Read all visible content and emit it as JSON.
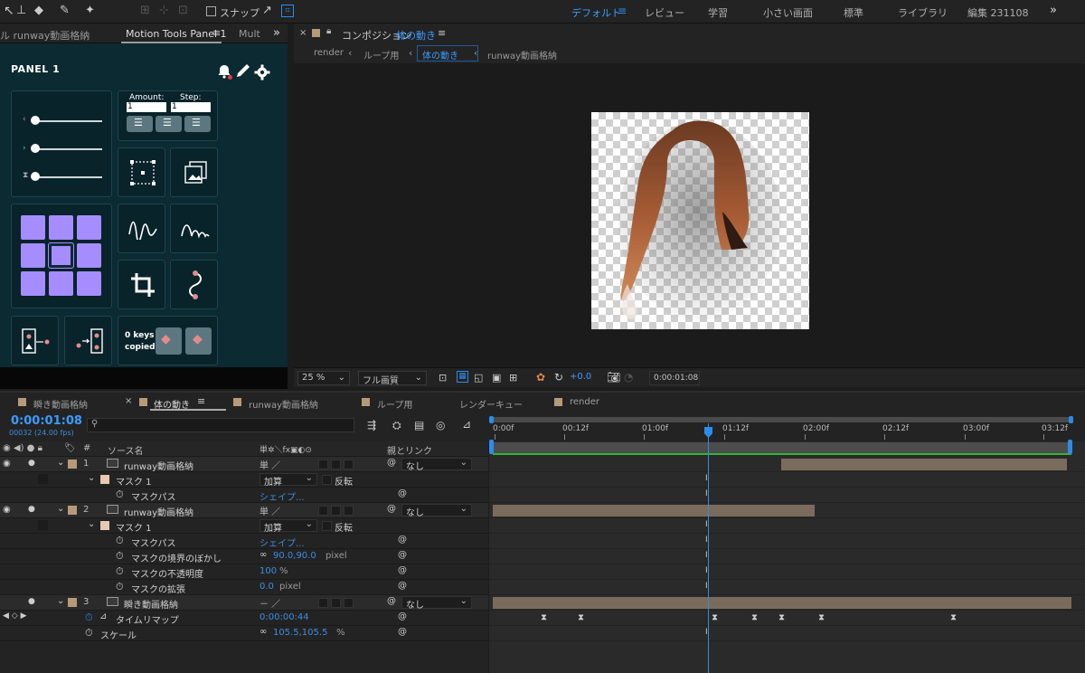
{
  "topbar": {
    "snap_label": "スナップ",
    "workspaces": [
      "デフォルト",
      "レビュー",
      "学習",
      "小さい画面",
      "標準",
      "ライブラリ",
      "編集 231108"
    ],
    "active_workspace": "デフォルト"
  },
  "left_tabs": {
    "project_tab": "ル runway動画格納",
    "panel_tab": "Motion Tools Panel 1",
    "multi_tab": "Mult"
  },
  "motion_tools": {
    "panel_title": "PANEL 1",
    "amount_label": "Amount:",
    "step_label": "Step:",
    "amount_value": "1",
    "step_value": "1",
    "keys_copied": "0 keys copied"
  },
  "comp": {
    "tab_label": "コンポジション",
    "comp_name": "体の動き",
    "breadcrumbs": [
      "render",
      "ループ用",
      "体の動き",
      "runway動画格納"
    ],
    "zoom": "25 %",
    "quality": "フル画質",
    "exposure": "+0.0",
    "timecode": "0:00:01:08"
  },
  "timeline": {
    "tabs": [
      "瞬き動画格納",
      "体の動き",
      "runway動画格納",
      "ループ用",
      "レンダーキュー",
      "render"
    ],
    "active_tab": "体の動き",
    "current_time": "0:00:01:08",
    "frame_info": "00032 (24.00 fps)",
    "ruler_labels": [
      "0:00f",
      "00:12f",
      "01:00f",
      "01:12f",
      "02:00f",
      "02:12f",
      "03:00f",
      "03:12f"
    ],
    "column_source": "ソース名",
    "column_parent": "親とリンク",
    "rows": [
      {
        "kind": "layer",
        "num": "1",
        "name": "runway動画格納",
        "parent": "なし"
      },
      {
        "kind": "mask",
        "name": "マスク 1",
        "mode": "加算",
        "invert": "反転"
      },
      {
        "kind": "prop",
        "name": "マスクパス",
        "value": "シェイプ..."
      },
      {
        "kind": "layer",
        "num": "2",
        "name": "runway動画格納",
        "parent": "なし"
      },
      {
        "kind": "mask",
        "name": "マスク 1",
        "mode": "加算",
        "invert": "反転"
      },
      {
        "kind": "prop",
        "name": "マスクパス",
        "value": "シェイプ..."
      },
      {
        "kind": "prop",
        "name": "マスクの境界のぼかし",
        "value": "90.0,90.0",
        "unit": "pixel"
      },
      {
        "kind": "prop",
        "name": "マスクの不透明度",
        "value": "100",
        "unit": "%"
      },
      {
        "kind": "prop",
        "name": "マスクの拡張",
        "value": "0.0",
        "unit": "pixel"
      },
      {
        "kind": "layer",
        "num": "3",
        "name": "瞬き動画格納",
        "parent": "なし"
      },
      {
        "kind": "prop",
        "name": "タイムリマップ",
        "value": "0:00:00:44"
      },
      {
        "kind": "prop",
        "name": "スケール",
        "value": "105.5,105.5",
        "unit": "%"
      }
    ]
  },
  "colors": {
    "accent": "#2d8ceb",
    "panel_bg": "#0b2a31",
    "grid_purple": "#a58cff",
    "label_tan": "#b79a7a"
  }
}
